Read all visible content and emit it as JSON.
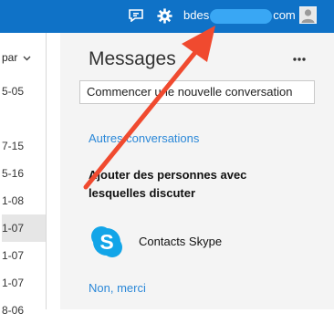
{
  "topbar": {
    "account_prefix": "bdes",
    "account_suffix": "com",
    "icons": [
      "chat-icon",
      "gear-icon",
      "avatar-icon"
    ],
    "bg_color": "#0f72c7"
  },
  "left_list": {
    "sort_label": "par",
    "dates": [
      "5-05",
      "7-15",
      "5-16",
      "1-08",
      "1-07",
      "1-07",
      "1-07",
      "8-06"
    ],
    "selected_index": 4
  },
  "messages": {
    "title": "Messages",
    "more_icon": "more-dots-icon",
    "search_placeholder": "Commencer une nouvelle conversation",
    "other_conversations": "Autres conversations",
    "add_people_heading": "Ajouter des personnes avec lesquelles discuter",
    "skype_contacts": "Contacts Skype",
    "dismiss_link": "Non, merci"
  },
  "annotation": {
    "arrow_color": "#f04a2f"
  }
}
